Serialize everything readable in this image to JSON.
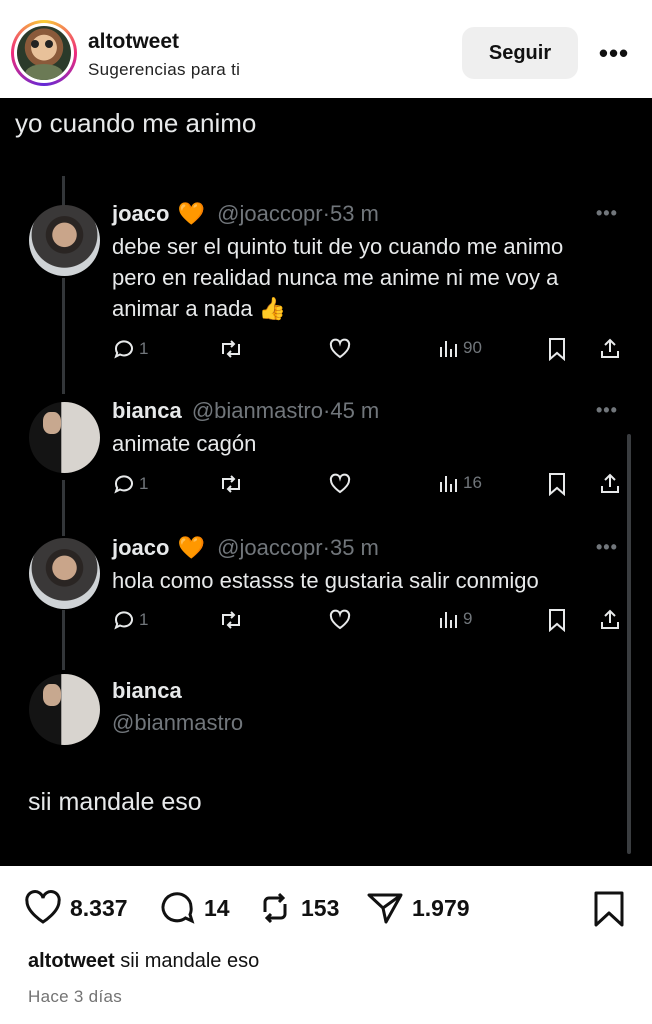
{
  "header": {
    "account": "altotweet",
    "subtitle": "Sugerencias para ti",
    "follow_label": "Seguir",
    "more_label": "•••"
  },
  "post": {
    "caption_top": "yo cuando me animo",
    "tweets": [
      {
        "name": "joaco",
        "heart": "🧡",
        "handle": "@joaccopr",
        "time": "53 m",
        "text": "debe ser el quinto tuit de yo cuando me animo pero en realidad nunca me anime ni me voy a animar a nada 👍",
        "replies": "1",
        "views": "90"
      },
      {
        "name": "bianca",
        "handle": "@bianmastro",
        "time": "45 m",
        "text": "animate cagón",
        "replies": "1",
        "views": "16"
      },
      {
        "name": "joaco",
        "heart": "🧡",
        "handle": "@joaccopr",
        "time": "35 m",
        "text": "hola como estasss te gustaria salir conmigo",
        "replies": "1",
        "views": "9"
      }
    ],
    "reply_author": {
      "name": "bianca",
      "handle": "@bianmastro"
    },
    "reply_text": "sii mandale eso",
    "separator": "·",
    "tweet_more": "•••"
  },
  "actions": {
    "likes": "8.337",
    "comments": "14",
    "reposts": "153",
    "shares": "1.979"
  },
  "caption": {
    "account": "altotweet",
    "text": "sii mandale eso"
  },
  "timestamp": "Hace 3 días",
  "colors": {
    "heart_accent": "#f28c28",
    "tweet_bg": "#000000",
    "muted": "#71767b",
    "follow_bg": "#efefef"
  }
}
